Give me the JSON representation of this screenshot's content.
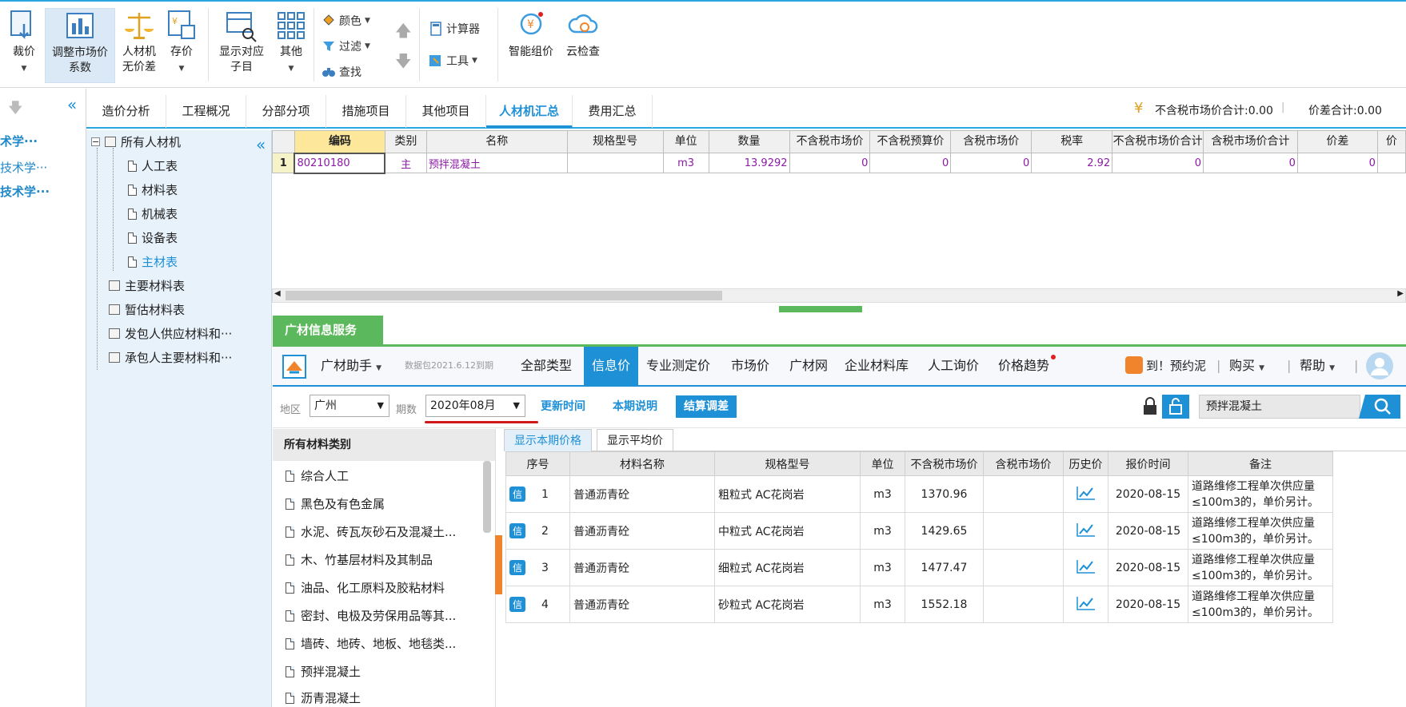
{
  "toolbar": {
    "buttons": [
      {
        "label": "裁价"
      },
      {
        "label": "调整市场价系数",
        "line1": "调整市场价",
        "line2": "系数"
      },
      {
        "label": "人材机无价差",
        "line1": "人材机",
        "line2": "无价差"
      },
      {
        "label": "存价"
      },
      {
        "label": "显示对应子目",
        "line1": "显示对应",
        "line2": "子目"
      },
      {
        "label": "其他"
      },
      {
        "label": "智能组价"
      },
      {
        "label": "云检查"
      }
    ],
    "color_label": "颜色",
    "filter_label": "过滤",
    "find_label": "查找",
    "calculator_label": "计算器",
    "tools_label": "工具"
  },
  "leftnav": {
    "items": [
      "术学···",
      "技术学···",
      "技术学···"
    ]
  },
  "tabs": {
    "items": [
      "造价分析",
      "工程概况",
      "分部分项",
      "措施项目",
      "其他项目",
      "人材机汇总",
      "费用汇总"
    ],
    "active": "人材机汇总",
    "sum_market": "不含税市场价合计:0.00",
    "sum_diff": "价差合计:0.00"
  },
  "tree": {
    "root": "所有人材机",
    "children": [
      "人工表",
      "材料表",
      "机械表",
      "设备表",
      "主材表"
    ],
    "selected": "主材表",
    "others": [
      "主要材料表",
      "暂估材料表",
      "发包人供应材料和···",
      "承包人主要材料和···"
    ]
  },
  "grid": {
    "headers": [
      "编码",
      "类别",
      "名称",
      "规格型号",
      "单位",
      "数量",
      "不含税市场价",
      "不含税预算价",
      "含税市场价",
      "税率",
      "不含税市场价合计",
      "含税市场价合计",
      "价差",
      "价"
    ],
    "rows": [
      {
        "no": "1",
        "code": "80210180",
        "type": "主",
        "name": "预拌混凝土",
        "spec": "",
        "unit": "m3",
        "qty": "13.9292",
        "market": "0",
        "budget": "0",
        "tax_market": "0",
        "rate": "2.92",
        "sum_market": "0",
        "sum_tax_market": "0",
        "diff": "0"
      }
    ]
  },
  "service": {
    "tab_label": "广材信息服务",
    "assistant": "广材助手",
    "data_pack": "数据包2021.6.12到期",
    "nav": [
      "全部类型",
      "信息价",
      "专业测定价",
      "市场价",
      "广材网",
      "企业材料库",
      "人工询价",
      "价格趋势"
    ],
    "active_nav": "信息价",
    "promo": "到！预约泥",
    "buy": "购买",
    "help": "帮助"
  },
  "filter": {
    "region_label": "地区",
    "region_value": "广州",
    "period_label": "期数",
    "period_value": "2020年08月",
    "update_time": "更新时间",
    "period_note": "本期说明",
    "settle": "结算调差",
    "search_value": "预拌混凝土"
  },
  "categories": {
    "header": "所有材料类别",
    "items": [
      "综合人工",
      "黑色及有色金属",
      "水泥、砖瓦灰砂石及混凝土...",
      "木、竹基层材料及其制品",
      "油品、化工原料及胶粘材料",
      "密封、电极及劳保用品等其...",
      "墙砖、地砖、地板、地毯类...",
      "预拌混凝土",
      "沥青混凝土"
    ]
  },
  "price": {
    "tabs": [
      "显示本期价格",
      "显示平均价"
    ],
    "headers": [
      "序号",
      "材料名称",
      "规格型号",
      "单位",
      "不含税市场价",
      "含税市场价",
      "历史价",
      "报价时间",
      "备注"
    ],
    "badge": "信",
    "rows": [
      {
        "no": "1",
        "name": "普通沥青砼",
        "spec": "粗粒式 AC花岗岩",
        "unit": "m3",
        "price": "1370.96",
        "tax_price": "",
        "date": "2020-08-15",
        "note1": "道路维修工程单次供应量",
        "note2": "≤100m3的，单价另计。"
      },
      {
        "no": "2",
        "name": "普通沥青砼",
        "spec": "中粒式 AC花岗岩",
        "unit": "m3",
        "price": "1429.65",
        "tax_price": "",
        "date": "2020-08-15",
        "note1": "道路维修工程单次供应量",
        "note2": "≤100m3的，单价另计。"
      },
      {
        "no": "3",
        "name": "普通沥青砼",
        "spec": "细粒式 AC花岗岩",
        "unit": "m3",
        "price": "1477.47",
        "tax_price": "",
        "date": "2020-08-15",
        "note1": "道路维修工程单次供应量",
        "note2": "≤100m3的，单价另计。"
      },
      {
        "no": "4",
        "name": "普通沥青砼",
        "spec": "砂粒式 AC花岗岩",
        "unit": "m3",
        "price": "1552.18",
        "tax_price": "",
        "date": "2020-08-15",
        "note1": "道路维修工程单次供应量",
        "note2": "≤100m3的，单价另计。"
      }
    ]
  },
  "colors": {
    "accent": "#1e90d6",
    "green": "#5cb85c",
    "underline": "#d01818",
    "orange": "#f0842c"
  }
}
